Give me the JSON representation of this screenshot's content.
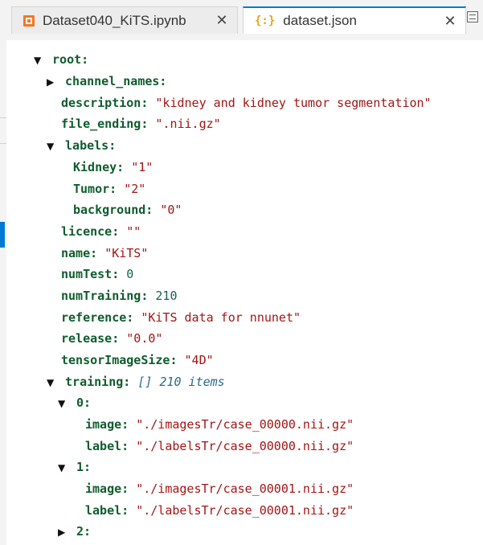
{
  "tabs": [
    {
      "label": "Dataset040_KiTS.ipynb",
      "icon": "notebook-icon"
    },
    {
      "label": "dataset.json",
      "icon": "json-icon"
    }
  ],
  "close_glyph": "✕",
  "json_icon_glyph": "{:}",
  "tree": {
    "root_key": "root:",
    "channel_names_key": "channel_names:",
    "description_key": "description:",
    "description_val": "\"kidney and kidney tumor segmentation\"",
    "file_ending_key": "file_ending:",
    "file_ending_val": "\".nii.gz\"",
    "labels_key": "labels:",
    "kidney_key": "Kidney:",
    "kidney_val": "\"1\"",
    "tumor_key": "Tumor:",
    "tumor_val": "\"2\"",
    "background_key": "background:",
    "background_val": "\"0\"",
    "licence_key": "licence:",
    "licence_val": "\"\"",
    "name_key": "name:",
    "name_val": "\"KiTS\"",
    "numtest_key": "numTest:",
    "numtest_val": "0",
    "numtraining_key": "numTraining:",
    "numtraining_val": "210",
    "reference_key": "reference:",
    "reference_val": "\"KiTS data for nnunet\"",
    "release_key": "release:",
    "release_val": "\"0.0\"",
    "tensor_key": "tensorImageSize:",
    "tensor_val": "\"4D\"",
    "training_key": "training:",
    "training_meta": "[]  210 items",
    "item0_key": "0:",
    "item0_image_key": "image:",
    "item0_image_val": "\"./imagesTr/case_00000.nii.gz\"",
    "item0_label_key": "label:",
    "item0_label_val": "\"./labelsTr/case_00000.nii.gz\"",
    "item1_key": "1:",
    "item1_image_key": "image:",
    "item1_image_val": "\"./imagesTr/case_00001.nii.gz\"",
    "item1_label_key": "label:",
    "item1_label_val": "\"./labelsTr/case_00001.nii.gz\"",
    "item2_key": "2:"
  },
  "twisty": {
    "expanded": "▼",
    "collapsed": "▶"
  }
}
